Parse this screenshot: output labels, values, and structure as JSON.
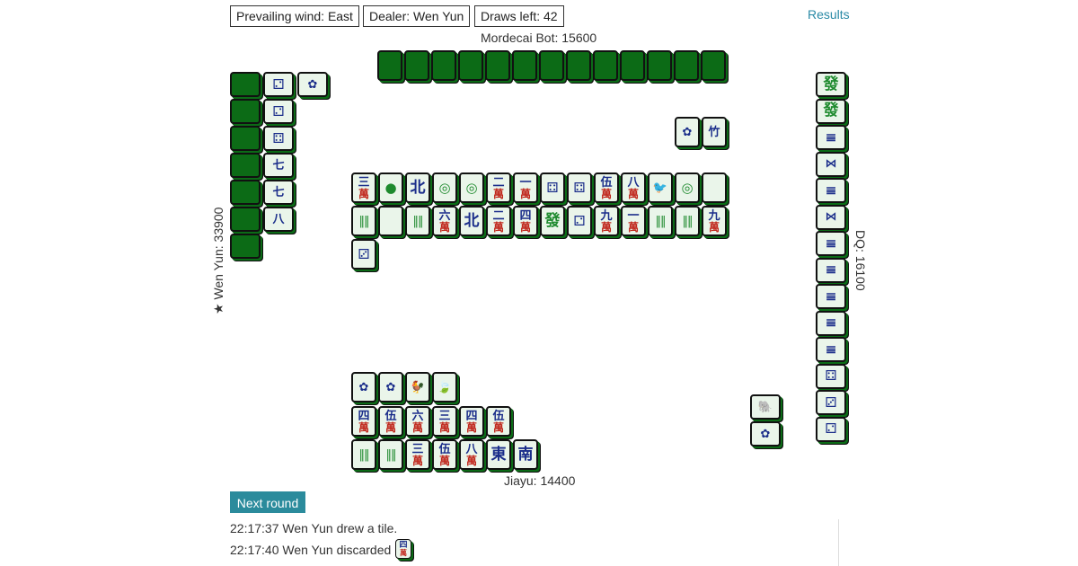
{
  "status": {
    "prevailing_wind": "Prevailing wind: East",
    "dealer": "Dealer: Wen Yun",
    "draws_left": "Draws left: 42"
  },
  "results_link": "Results",
  "players": {
    "top": "Mordecai Bot: 15600",
    "left": "★ Wen Yun: 33900",
    "right": "DQ: 16100",
    "bottom": "Jiayu: 14400"
  },
  "tiles": {
    "top_hand_count": 13,
    "left_hand_count": 7,
    "right_melds": [
      "發",
      "發",
      "𝍣",
      "⋈",
      "𝍣",
      "⋈",
      "𝍣",
      "𝍣",
      "𝍣",
      "𝍣",
      "𝍣",
      "⚃",
      "⚂",
      "⚁"
    ],
    "left_melds": [
      "⚁",
      "⚁",
      "⚃",
      "七",
      "七",
      "八"
    ],
    "left_flower": "✿",
    "top_bonus": [
      "✿",
      "竹"
    ],
    "right_bonus": [
      "🐘",
      "✿"
    ],
    "discards_row1": [
      {
        "t": "三",
        "b": "萬"
      },
      {
        "t": "●",
        "b": ""
      },
      {
        "t": "北",
        "b": ""
      },
      {
        "t": "◎",
        "b": ""
      },
      {
        "t": "◎",
        "b": ""
      },
      {
        "t": "二",
        "b": "萬"
      },
      {
        "t": "一",
        "b": "萬"
      },
      {
        "t": "⚃",
        "b": ""
      },
      {
        "t": "⚃",
        "b": ""
      },
      {
        "t": "伍",
        "b": "萬"
      },
      {
        "t": "八",
        "b": "萬"
      },
      {
        "t": "🐦",
        "b": ""
      },
      {
        "t": "◎",
        "b": ""
      },
      {
        "t": "",
        "b": ""
      }
    ],
    "discards_row2": [
      {
        "t": "‖",
        "b": ""
      },
      {
        "t": "",
        "b": ""
      },
      {
        "t": "‖",
        "b": ""
      },
      {
        "t": "六",
        "b": "萬"
      },
      {
        "t": "北",
        "b": ""
      },
      {
        "t": "二",
        "b": "萬"
      },
      {
        "t": "四",
        "b": "萬"
      },
      {
        "t": "發",
        "b": ""
      },
      {
        "t": "⚁",
        "b": ""
      },
      {
        "t": "九",
        "b": "萬"
      },
      {
        "t": "一",
        "b": "萬"
      },
      {
        "t": "‖",
        "b": ""
      },
      {
        "t": "‖",
        "b": ""
      },
      {
        "t": "九",
        "b": "萬"
      }
    ],
    "discards_row3": [
      {
        "t": "⚂",
        "b": ""
      }
    ],
    "bottom_bonus": [
      "✿",
      "✿",
      "🐓",
      "🍃"
    ],
    "bottom_meld": [
      {
        "t": "四",
        "b": "萬"
      },
      {
        "t": "伍",
        "b": "萬"
      },
      {
        "t": "六",
        "b": "萬"
      },
      {
        "t": "三",
        "b": "萬"
      },
      {
        "t": "四",
        "b": "萬"
      },
      {
        "t": "伍",
        "b": "萬"
      }
    ],
    "bottom_hand": [
      {
        "t": "‖",
        "b": ""
      },
      {
        "t": "‖",
        "b": ""
      },
      {
        "t": "三",
        "b": "萬"
      },
      {
        "t": "伍",
        "b": "萬"
      },
      {
        "t": "八",
        "b": "萬"
      },
      {
        "t": "東",
        "b": ""
      },
      {
        "t": "南",
        "b": ""
      }
    ]
  },
  "next_round_label": "Next round",
  "log": [
    "22:17:37 Wen Yun drew a tile.",
    "22:17:40 Wen Yun discarded"
  ],
  "colors": {
    "tile_green": "#0c6b16",
    "tile_face": "#eaf5ea",
    "accent": "#2b8b9c"
  }
}
